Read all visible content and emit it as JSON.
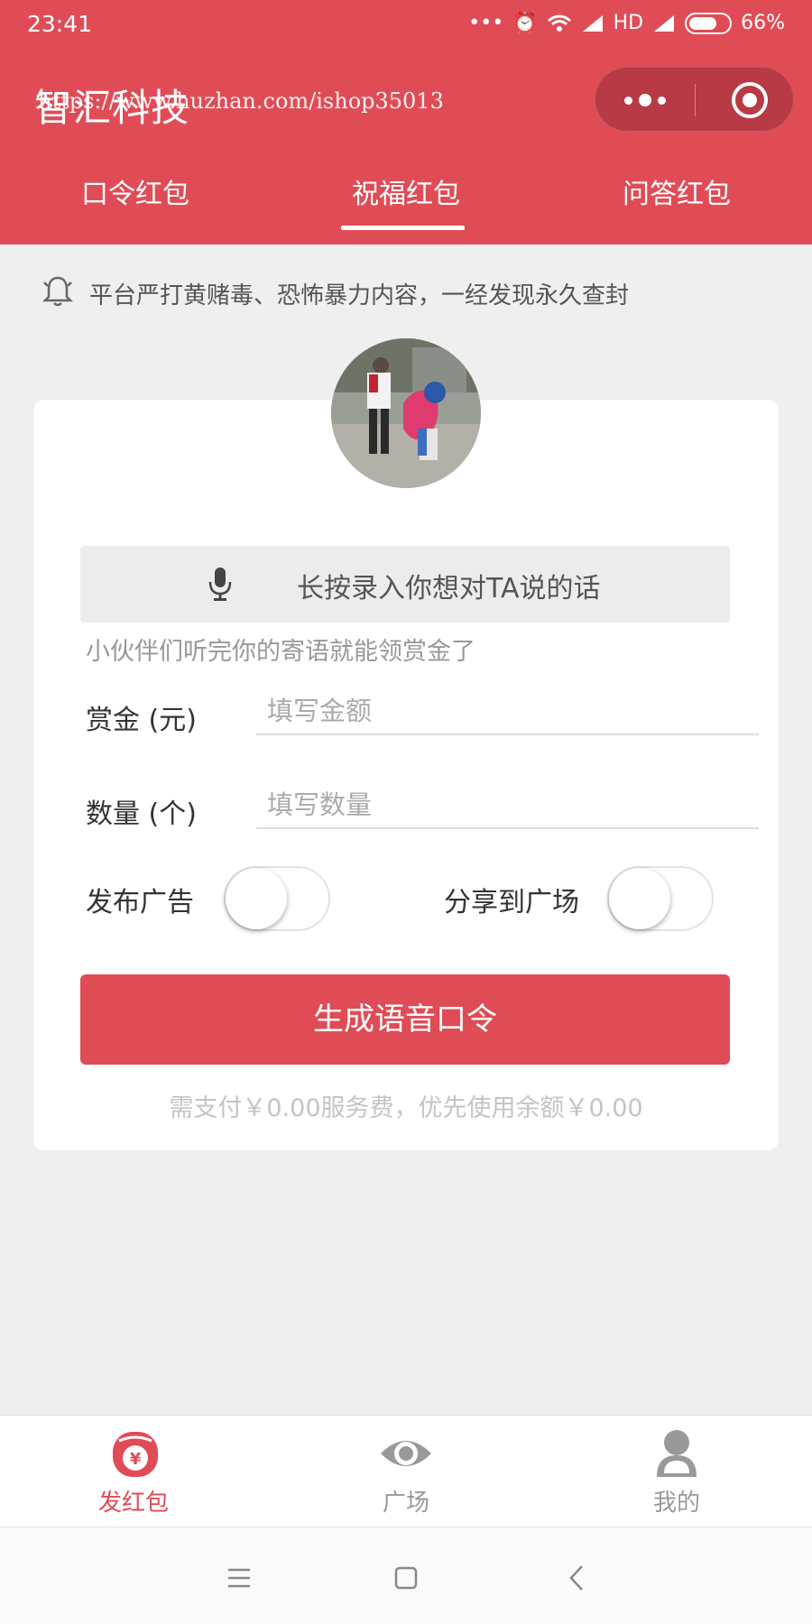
{
  "status_bar": {
    "time": "23:41",
    "network": "HD",
    "battery": "66%",
    "icons": [
      "dots-icon",
      "alarm-icon",
      "wifi-icon",
      "signal-icon",
      "battery-icon"
    ]
  },
  "nav": {
    "title": "智汇科技",
    "watermark": "https://www.huzhan.com/ishop35013",
    "capsule_icons": [
      "more-icon",
      "close-icon"
    ]
  },
  "tabs": [
    {
      "label": "口令红包",
      "active": false
    },
    {
      "label": "祝福红包",
      "active": true
    },
    {
      "label": "问答红包",
      "active": false
    }
  ],
  "notice": {
    "icon": "bell-icon",
    "text": "平台严打黄赌毒、恐怖暴力内容，一经发现永久查封"
  },
  "form": {
    "avatar": "avatar",
    "record_label": "长按录入你想对TA说的话",
    "hint": "小伙伴们听完你的寄语就能领赏金了",
    "amount_label": "赏金 (元)",
    "amount_placeholder": "填写金额",
    "count_label": "数量 (个)",
    "count_placeholder": "填写数量",
    "ad_label": "发布广告",
    "ad_on": false,
    "share_label": "分享到广场",
    "share_on": false,
    "submit_label": "生成语音口令",
    "fee_text": "需支付￥0.00服务费，优先使用余额￥0.00"
  },
  "tabbar": [
    {
      "label": "发红包",
      "icon": "red-packet-icon",
      "active": true
    },
    {
      "label": "广场",
      "icon": "eye-icon",
      "active": false
    },
    {
      "label": "我的",
      "icon": "user-icon",
      "active": false
    }
  ],
  "system_nav": [
    "menu-icon",
    "home-icon",
    "back-icon"
  ],
  "colors": {
    "accent": "#e04c56",
    "background": "#efefef"
  }
}
